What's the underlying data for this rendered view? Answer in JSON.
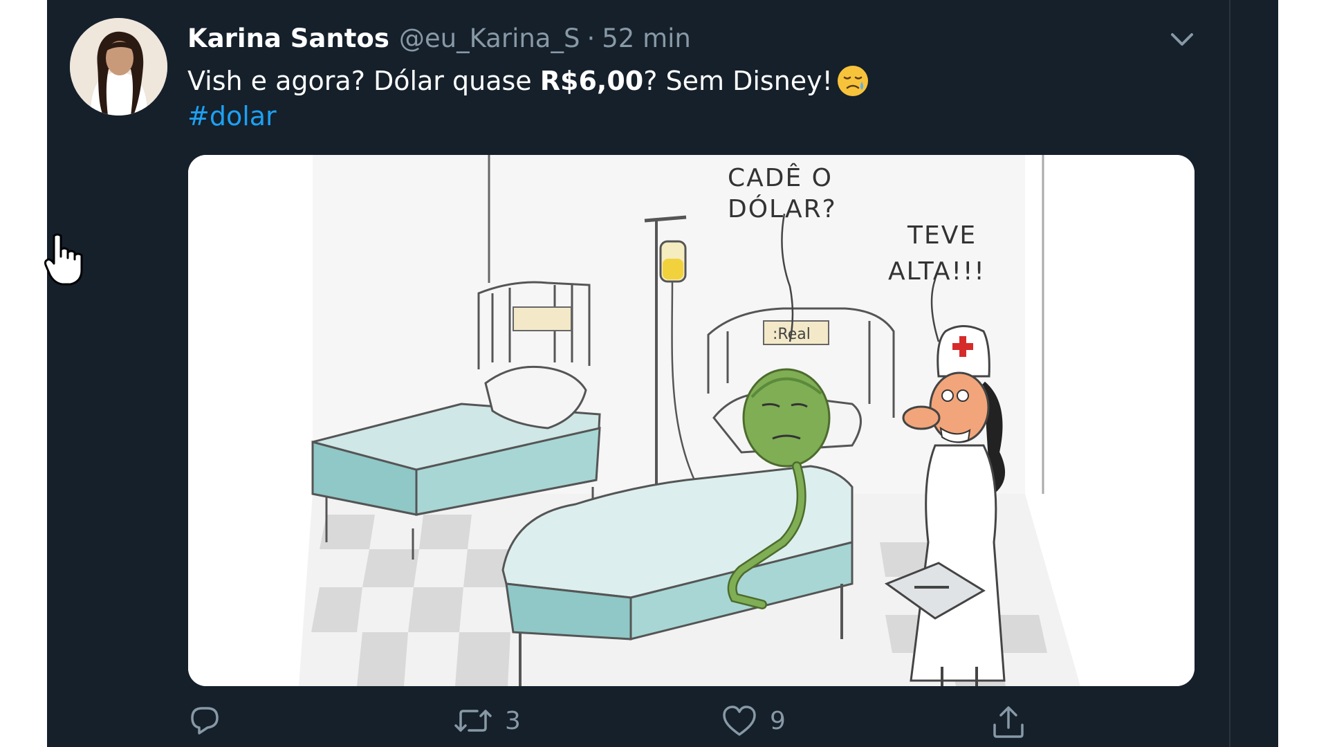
{
  "tweet": {
    "author_name": "Karina Santos",
    "author_handle": "@eu_Karina_S",
    "separator": "·",
    "time": "52 min",
    "text_before": "Vish e agora? Dólar quase ",
    "text_bold": "R$6,00",
    "text_after": "? Sem Disney!",
    "emoji": "sad-relieved-face-emoji",
    "hashtag": "#dolar"
  },
  "cartoon": {
    "speech_patient_line1": "CADÊ O",
    "speech_patient_line2": "DÓLAR?",
    "speech_nurse_line1": "TEVE",
    "speech_nurse_line2": "ALTA!!!",
    "bed_label": ":Real"
  },
  "actions": {
    "reply_icon": "reply-bubble-icon",
    "retweet_icon": "retweet-icon",
    "retweet_count": "3",
    "like_icon": "heart-icon",
    "like_count": "9",
    "share_icon": "share-upload-icon"
  },
  "colors": {
    "background": "#15202b",
    "text": "#ffffff",
    "muted": "#8899a6",
    "link": "#1da1f2"
  }
}
